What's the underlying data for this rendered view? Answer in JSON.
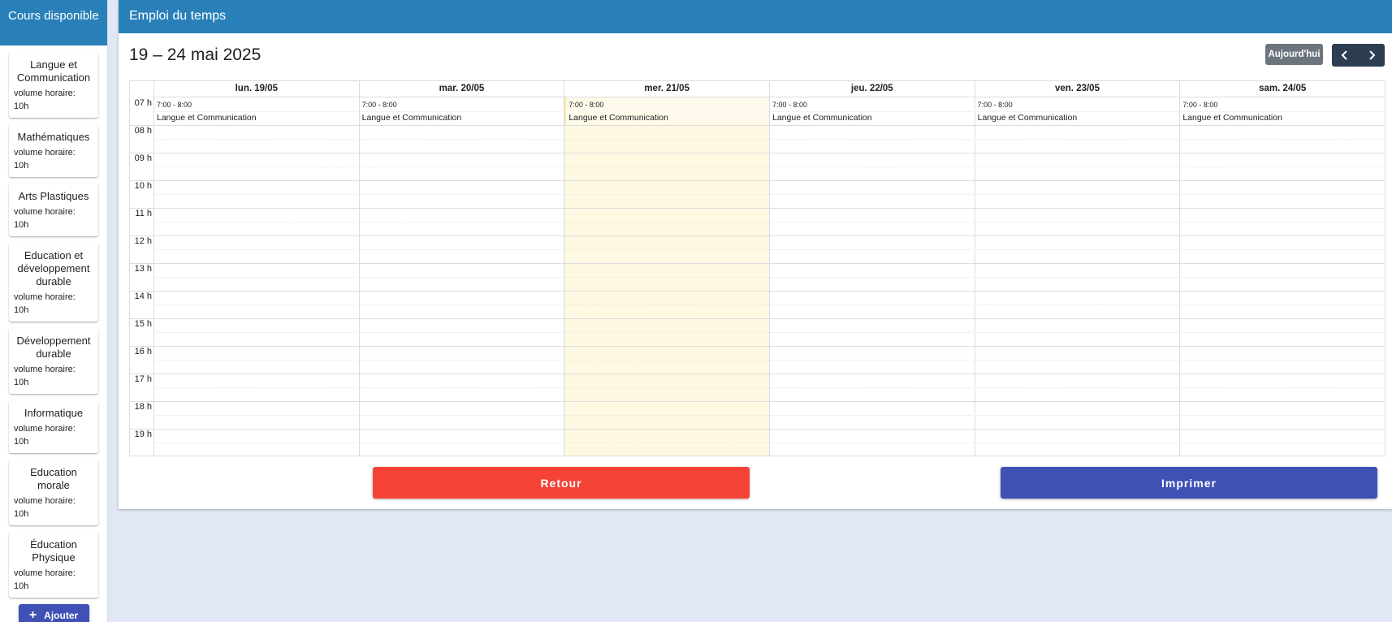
{
  "sidebar": {
    "title": "Cours disponible",
    "courses": [
      {
        "name": "Langue et Communication",
        "volume_label": "volume horaire:",
        "volume": "10h"
      },
      {
        "name": "Mathématiques",
        "volume_label": "volume horaire:",
        "volume": "10h"
      },
      {
        "name": "Arts Plastiques",
        "volume_label": "volume horaire:",
        "volume": "10h"
      },
      {
        "name": "Education et développement durable",
        "volume_label": "volume horaire:",
        "volume": "10h"
      },
      {
        "name": "Développement durable",
        "volume_label": "volume horaire:",
        "volume": "10h"
      },
      {
        "name": "Informatique",
        "volume_label": "volume horaire:",
        "volume": "10h"
      },
      {
        "name": "Education morale",
        "volume_label": "volume horaire:",
        "volume": "10h"
      },
      {
        "name": "Éducation Physique",
        "volume_label": "volume horaire:",
        "volume": "10h"
      }
    ],
    "add_label": "Ajouter"
  },
  "main": {
    "title": "Emploi du temps"
  },
  "calendar": {
    "range_title": "19 – 24 mai 2025",
    "today_label": "Aujourd'hui",
    "days": [
      "lun. 19/05",
      "mar. 20/05",
      "mer. 21/05",
      "jeu. 22/05",
      "ven. 23/05",
      "sam. 24/05"
    ],
    "today_index": 2,
    "hours": [
      "07 h",
      "08 h",
      "09 h",
      "10 h",
      "11 h",
      "12 h",
      "13 h",
      "14 h",
      "15 h",
      "16 h",
      "17 h",
      "18 h",
      "19 h"
    ],
    "events": [
      {
        "day": 0,
        "time": "7:00 - 8:00",
        "title": "Langue et Communication"
      },
      {
        "day": 1,
        "time": "7:00 - 8:00",
        "title": "Langue et Communication"
      },
      {
        "day": 2,
        "time": "7:00 - 8:00",
        "title": "Langue et Communication"
      },
      {
        "day": 3,
        "time": "7:00 - 8:00",
        "title": "Langue et Communication"
      },
      {
        "day": 4,
        "time": "7:00 - 8:00",
        "title": "Langue et Communication"
      },
      {
        "day": 5,
        "time": "7:00 - 8:00",
        "title": "Langue et Communication"
      }
    ]
  },
  "actions": {
    "back_label": "Retour",
    "print_label": "Imprimer"
  },
  "colors": {
    "header_blue": "#2980b9",
    "primary": "#3f51b5",
    "danger": "#f44336",
    "today_bg": "#fdf8e1",
    "nav_dark": "#2c3e50",
    "today_btn": "#6c757d"
  }
}
